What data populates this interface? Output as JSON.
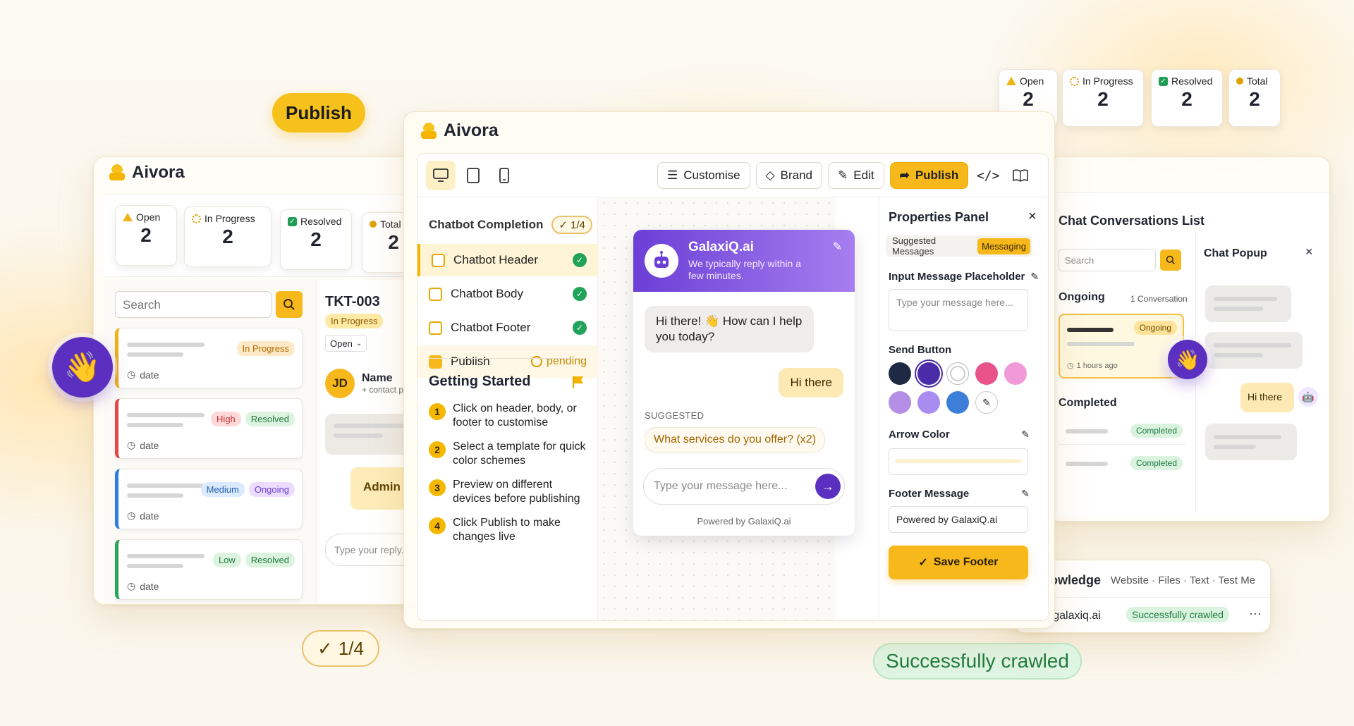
{
  "floating": {
    "publish_pill": "Publish",
    "progress_pill": "1/4",
    "crawled_pill": "Successfully crawled"
  },
  "top_stats": [
    {
      "label": "Open",
      "value": "2"
    },
    {
      "label": "In Progress",
      "value": "2"
    },
    {
      "label": "Resolved",
      "value": "2"
    },
    {
      "label": "Total",
      "value": "2"
    }
  ],
  "left_app": {
    "title": "Aivora",
    "stats": [
      {
        "label": "Open",
        "value": "2"
      },
      {
        "label": "In Progress",
        "value": "2"
      },
      {
        "label": "Resolved",
        "value": "2"
      },
      {
        "label": "Total",
        "value": "2"
      }
    ],
    "search_placeholder": "Search",
    "tickets": [
      {
        "tags": [
          "In Progress"
        ],
        "date": "date",
        "accent": "#f0b216"
      },
      {
        "tags": [
          "High",
          "Resolved"
        ],
        "date": "date",
        "accent": "#e24a4a"
      },
      {
        "tags": [
          "Medium",
          "Ongoing"
        ],
        "date": "date",
        "accent": "#2f7fd8"
      },
      {
        "tags": [
          "Low",
          "Resolved"
        ],
        "date": "date",
        "accent": "#2aa457"
      }
    ],
    "detail": {
      "id": "TKT-003",
      "status": "In Progress",
      "select": "Open",
      "avatar": "JD",
      "name": "Name",
      "contact": "+ contact p",
      "admin": "Admin",
      "reply_placeholder": "Type your reply..."
    }
  },
  "main_app": {
    "title": "Aivora",
    "toolbar": {
      "customise": "Customise",
      "brand": "Brand",
      "edit": "Edit",
      "publish": "Publish"
    },
    "completion": {
      "title": "Chatbot Completion",
      "badge": "1/4",
      "items": [
        {
          "label": "Chatbot Header",
          "state": "done"
        },
        {
          "label": "Chatbot Body",
          "state": "done"
        },
        {
          "label": "Chatbot Footer",
          "state": "done"
        },
        {
          "label": "Publish",
          "state": "pending",
          "status": "pending"
        }
      ]
    },
    "getting_started": {
      "title": "Getting Started",
      "steps": [
        {
          "n": "1",
          "text": "Click on header, body, or footer to customise"
        },
        {
          "n": "2",
          "text": "Select a template for quick color schemes"
        },
        {
          "n": "3",
          "text": "Preview on different devices before publishing"
        },
        {
          "n": "4",
          "text": "Click Publish to make changes live"
        }
      ]
    },
    "chat": {
      "bot_name": "GalaxiQ.ai",
      "subtitle": "We typically reply within a few minutes.",
      "bot_msg": "Hi there! 👋 How can I help you today?",
      "user_msg": "Hi there",
      "suggested_label": "SUGGESTED",
      "suggestion": "What services do you offer? (x2)",
      "input_placeholder": "Type your message here...",
      "powered": "Powered by GalaxiQ.ai"
    },
    "properties": {
      "title": "Properties Panel",
      "tab_suggested": "Suggested Messages",
      "tab_messaging": "Messaging",
      "input_label": "Input Message Placeholder",
      "input_placeholder": "Type your message here...",
      "send_label": "Send Button",
      "swatches": [
        "#1e2a44",
        "#4a2ba8",
        "#ffffff",
        "#e8538a",
        "#f29ad8",
        "#b58ee6",
        "#a98cf0",
        "#3d7fd8"
      ],
      "arrow_label": "Arrow Color",
      "footer_label": "Footer Message",
      "footer_value": "Powered by GalaxiQ.ai",
      "save": "Save Footer"
    }
  },
  "right_app": {
    "list_title": "Chat Conversations List",
    "search_placeholder": "Search",
    "ongoing": "Ongoing",
    "count": "1 Conversation",
    "ongoing_tag": "Ongoing",
    "time": "1 hours ago",
    "completed": "Completed",
    "completed_tags": [
      "Completed",
      "Completed"
    ],
    "popup_title": "Chat Popup",
    "popup_msg": "Hi there"
  },
  "knowledge": {
    "title": "owledge",
    "tabs": "Website · Files · Text · Test Me",
    "site": "www.galaxiq.ai",
    "status": "Successfully crawled"
  }
}
